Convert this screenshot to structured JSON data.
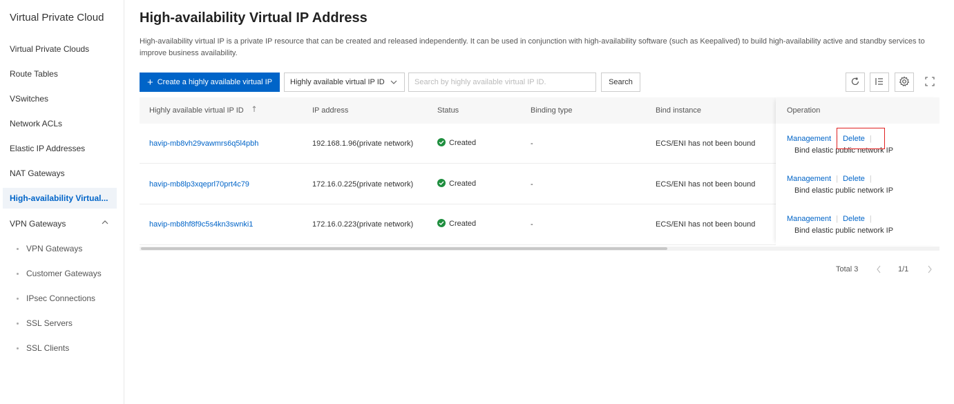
{
  "sidebar": {
    "title": "Virtual Private Cloud",
    "items": [
      {
        "label": "Virtual Private Clouds"
      },
      {
        "label": "Route Tables"
      },
      {
        "label": "VSwitches"
      },
      {
        "label": "Network ACLs"
      },
      {
        "label": "Elastic IP Addresses"
      },
      {
        "label": "NAT Gateways"
      },
      {
        "label": "High-availability Virtual..."
      },
      {
        "label": "VPN Gateways"
      }
    ],
    "sub_items": [
      {
        "label": "VPN Gateways"
      },
      {
        "label": "Customer Gateways"
      },
      {
        "label": "IPsec Connections"
      },
      {
        "label": "SSL Servers"
      },
      {
        "label": "SSL Clients"
      }
    ]
  },
  "header": {
    "title": "High-availability Virtual IP Address",
    "description": "High-availability virtual IP is a private IP resource that can be created and released independently. It can be used in conjunction with high-availability software (such as Keepalived) to build high-availability active and standby services to improve business availability."
  },
  "toolbar": {
    "create_label": "Create a highly available virtual IP",
    "filter_select": "Highly available virtual IP ID",
    "search_placeholder": "Search by highly available virtual IP ID.",
    "search_label": "Search"
  },
  "table": {
    "columns": {
      "id": "Highly available virtual IP ID",
      "ip": "IP address",
      "status": "Status",
      "binding_type": "Binding type",
      "bind_instance": "Bind instance",
      "operation": "Operation"
    },
    "rows": [
      {
        "id": "havip-mb8vh29vawmrs6q5l4pbh",
        "ip": "192.168.1.96(private network)",
        "status": "Created",
        "binding_type": "-",
        "bind_instance": "ECS/ENI has not been bound"
      },
      {
        "id": "havip-mb8lp3xqeprl70prt4c79",
        "ip": "172.16.0.225(private network)",
        "status": "Created",
        "binding_type": "-",
        "bind_instance": "ECS/ENI has not been bound"
      },
      {
        "id": "havip-mb8hf8f9c5s4kn3swnki1",
        "ip": "172.16.0.223(private network)",
        "status": "Created",
        "binding_type": "-",
        "bind_instance": "ECS/ENI has not been bound"
      }
    ],
    "op_labels": {
      "management": "Management",
      "delete": "Delete",
      "bind_eip": "Bind elastic public network IP"
    }
  },
  "pagination": {
    "total": "Total 3",
    "page": "1/1"
  },
  "colors": {
    "accent": "#0064c8",
    "success": "#1e8e3e",
    "highlight": "#e02020"
  }
}
